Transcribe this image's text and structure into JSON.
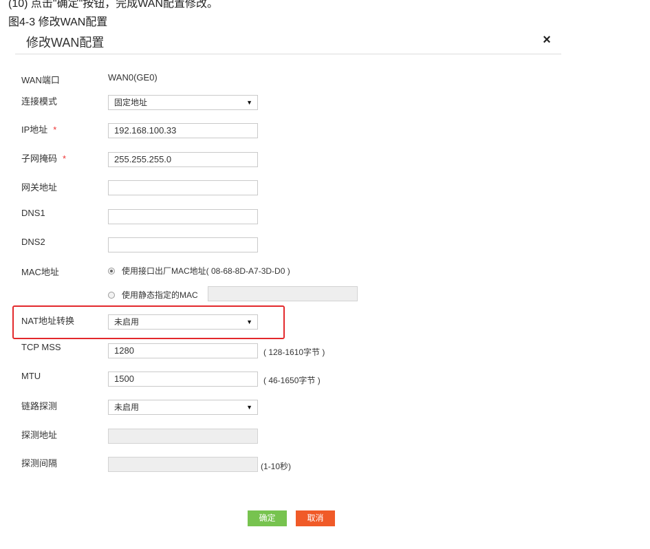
{
  "doc": {
    "top_cut_text": "(10) 点击\"确定\"按钮，完成WAN配置修改。",
    "figure_caption": "图4-3 修改WAN配置"
  },
  "dialog": {
    "title": "修改WAN配置",
    "close_symbol": "×"
  },
  "form": {
    "wan_port": {
      "label": "WAN端口",
      "value": "WAN0(GE0)"
    },
    "connection_mode": {
      "label": "连接模式",
      "selected": "固定地址"
    },
    "ip_address": {
      "label": "IP地址",
      "required_mark": "*",
      "value": "192.168.100.33"
    },
    "subnet_mask": {
      "label": "子网掩码",
      "required_mark": "*",
      "value": "255.255.255.0"
    },
    "gateway": {
      "label": "网关地址",
      "value": ""
    },
    "dns1": {
      "label": "DNS1",
      "value": ""
    },
    "dns2": {
      "label": "DNS2",
      "value": ""
    },
    "mac": {
      "label": "MAC地址",
      "option_factory": "使用接口出厂MAC地址( 08-68-8D-A7-3D-D0 )",
      "option_static": "使用静态指定的MAC",
      "selected": "factory",
      "static_value": ""
    },
    "nat": {
      "label": "NAT地址转换",
      "selected": "未启用"
    },
    "tcp_mss": {
      "label": "TCP MSS",
      "value": "1280",
      "hint": "( 128-1610字节 )"
    },
    "mtu": {
      "label": "MTU",
      "value": "1500",
      "hint": "( 46-1650字节 )"
    },
    "link_probe": {
      "label": "链路探测",
      "selected": "未启用"
    },
    "probe_address": {
      "label": "探测地址",
      "value": ""
    },
    "probe_interval": {
      "label": "探测间隔",
      "value": "",
      "hint": "(1-10秒)"
    }
  },
  "buttons": {
    "ok": "确定",
    "cancel": "取消"
  },
  "icons": {
    "close": "close-icon",
    "select_arrow": "chevron-down-icon",
    "radio": "radio-icon"
  },
  "colors": {
    "highlight": "#e3282b",
    "required": "#ee3333",
    "ok_button": "#77c34f",
    "cancel_button": "#f05a28",
    "disabled_field": "#eeeeee"
  }
}
